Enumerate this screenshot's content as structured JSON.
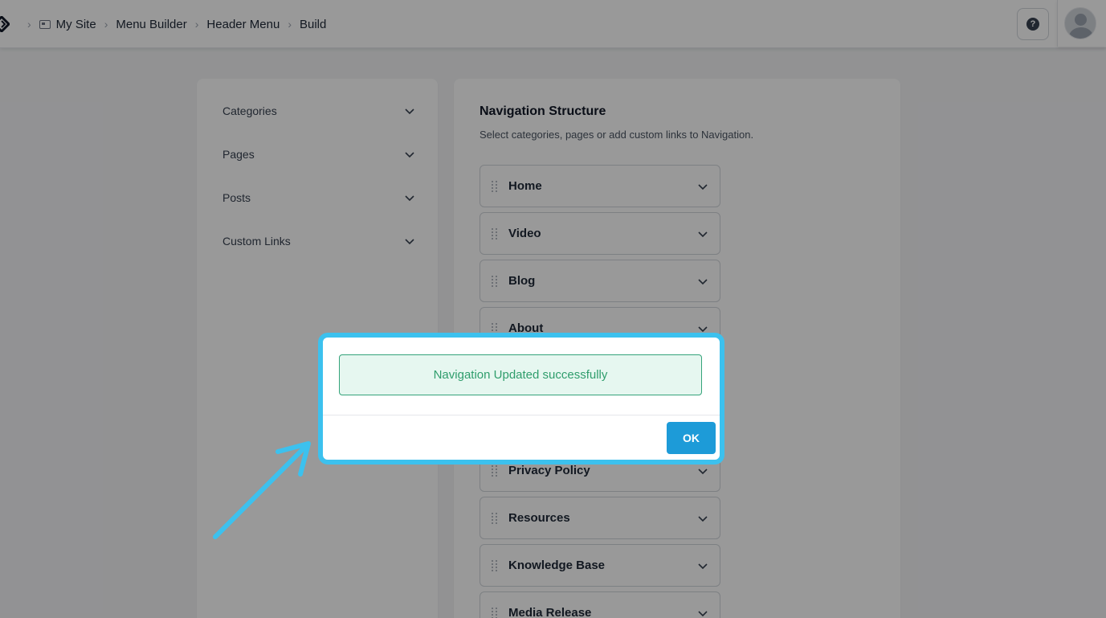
{
  "breadcrumbs": [
    "My Site",
    "Menu Builder",
    "Header Menu",
    "Build"
  ],
  "icons": {
    "logo": "diamond-logo-icon",
    "site": "site-window-icon",
    "separator": "chevron-right-icon",
    "help": "help-icon",
    "avatar": "user-avatar-icon",
    "expand": "chevron-down-icon",
    "drag": "drag-handle-icon",
    "annotation": "arrow-icon"
  },
  "help": {
    "symbol": "?"
  },
  "left_panel": {
    "items": [
      {
        "label": "Categories"
      },
      {
        "label": "Pages"
      },
      {
        "label": "Posts"
      },
      {
        "label": "Custom Links"
      }
    ]
  },
  "right_panel": {
    "title": "Navigation Structure",
    "subtitle": "Select categories, pages or add custom links to Navigation.",
    "items": [
      {
        "label": "Home"
      },
      {
        "label": "Video"
      },
      {
        "label": "Blog"
      },
      {
        "label": "About"
      },
      {
        "label": "Privacy Policy"
      },
      {
        "label": "Resources"
      },
      {
        "label": "Knowledge Base"
      },
      {
        "label": "Media Release"
      }
    ]
  },
  "modal": {
    "message": "Navigation Updated successfully",
    "ok_label": "OK"
  },
  "colors": {
    "highlight": "#3cc1ee",
    "ok_button": "#1d9bd8",
    "success_text": "#2f9d6c",
    "success_bg": "#e6f7f0"
  }
}
